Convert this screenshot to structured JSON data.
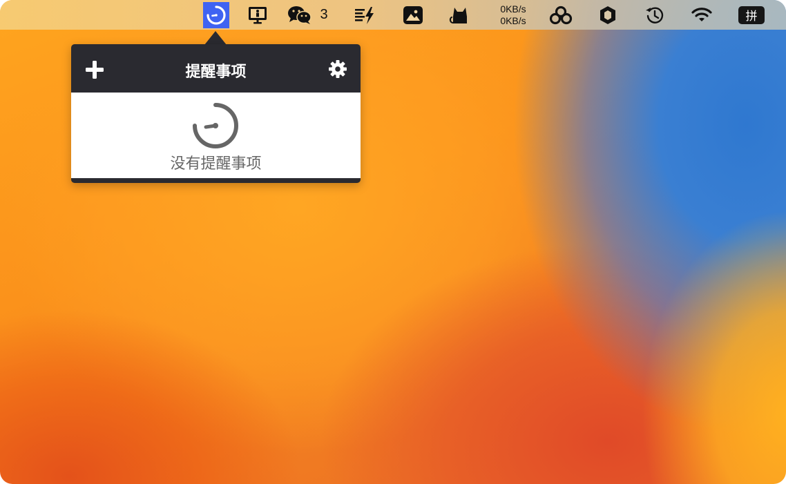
{
  "menubar": {
    "items": [
      {
        "icon": "reminder-timer-icon",
        "highlighted": true
      },
      {
        "icon": "presentation-monitor-icon"
      },
      {
        "icon": "wechat-icon",
        "count": "3"
      },
      {
        "icon": "text-lightning-icon"
      },
      {
        "icon": "photo-icon"
      },
      {
        "icon": "cat-icon"
      },
      {
        "icon": "net-speed",
        "upload": "0KB/s",
        "download": "0KB/s"
      },
      {
        "icon": "baidu-netdisk-icon"
      },
      {
        "icon": "hexagon-icon"
      },
      {
        "icon": "time-machine-icon"
      },
      {
        "icon": "wifi-icon"
      },
      {
        "icon": "input-method-badge",
        "label": "拼"
      }
    ],
    "highlight_color": "#3f63f2"
  },
  "popover": {
    "title": "提醒事项",
    "add_icon": "plus-icon",
    "settings_icon": "gear-icon",
    "empty_icon": "timer-icon",
    "empty_text": "没有提醒事项",
    "header_color": "#2a2a30"
  }
}
